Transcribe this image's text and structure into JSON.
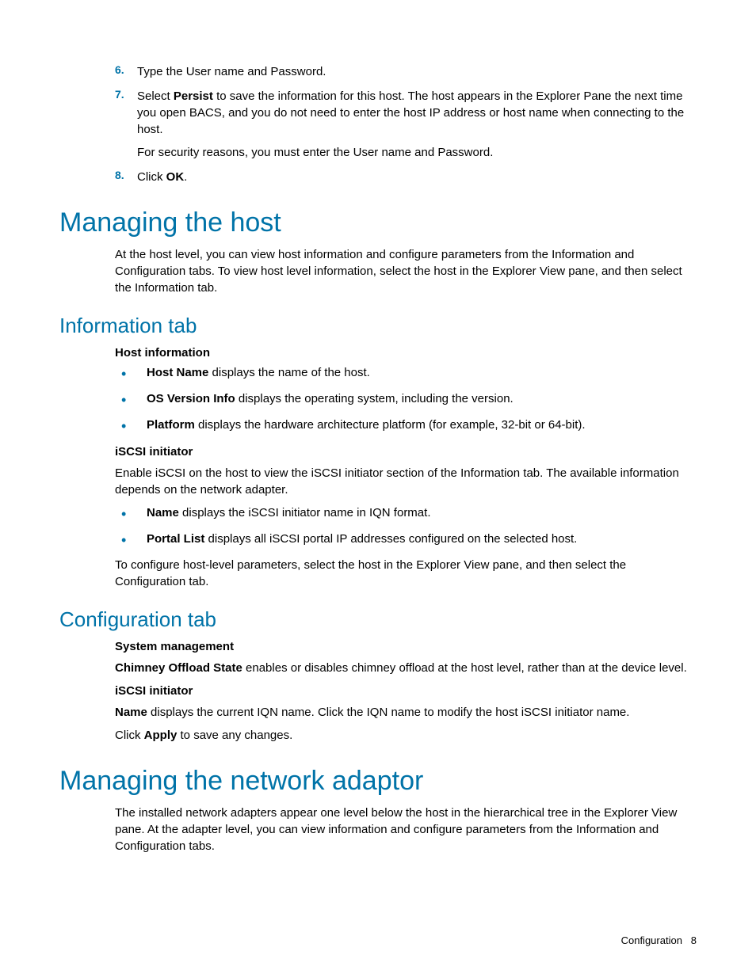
{
  "ol": {
    "num6": "6.",
    "item6": "Type the User name and Password.",
    "num7": "7.",
    "item7_pre": "Select ",
    "item7_b": "Persist",
    "item7_post": " to save the information for this host. The host appears in the Explorer Pane the next time you open BACS, and you do not need to enter the host IP address or host name when connecting to the host.",
    "item7_sub": "For security reasons, you must enter the User name and Password.",
    "num8": "8.",
    "item8_pre": "Click ",
    "item8_b": "OK",
    "item8_post": "."
  },
  "h1_host": "Managing the host",
  "p_host": "At the host level, you can view host information and configure parameters from the Information and Configuration tabs. To view host level information, select the host in the Explorer View pane, and then select the Information tab.",
  "h2_info": "Information tab",
  "label_hostinfo": "Host information",
  "hostinfo_items": [
    {
      "b": "Host Name",
      "t": " displays the name of the host."
    },
    {
      "b": "OS Version Info",
      "t": " displays the operating system, including the version."
    },
    {
      "b": "Platform",
      "t": " displays the hardware architecture platform (for example, 32-bit or 64-bit)."
    }
  ],
  "label_iscsi1": "iSCSI initiator",
  "p_iscsi1": "Enable iSCSI on the host to view the iSCSI initiator section of the Information tab. The available information depends on the network adapter.",
  "iscsi_items": [
    {
      "b": "Name",
      "t": " displays the iSCSI initiator name in IQN format."
    },
    {
      "b": "Portal List",
      "t": " displays all iSCSI portal IP addresses configured on the selected host."
    }
  ],
  "p_config_nav": "To configure host-level parameters, select the host in the Explorer View pane, and then select the Configuration tab.",
  "h2_config": "Configuration tab",
  "label_sysmgmt": "System management",
  "p_chimney_b": "Chimney Offload State",
  "p_chimney_t": " enables or disables chimney offload at the host level, rather than at the device level.",
  "label_iscsi2": "iSCSI initiator",
  "p_name_b": "Name",
  "p_name_t": " displays the current IQN name. Click the IQN name to modify the host iSCSI initiator name.",
  "p_apply_pre": "Click ",
  "p_apply_b": "Apply",
  "p_apply_post": " to save any changes.",
  "h1_adaptor": "Managing the network adaptor",
  "p_adaptor": "The installed network adapters appear one level below the host in the hierarchical tree in the Explorer View pane. At the adapter level, you can view information and configure parameters from the Information and Configuration tabs.",
  "footer_section": "Configuration",
  "footer_page": "8"
}
